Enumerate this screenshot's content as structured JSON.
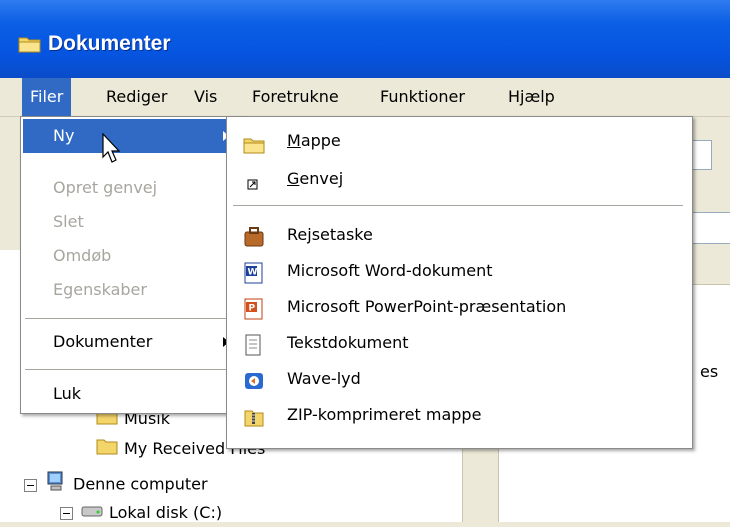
{
  "window": {
    "title": "Dokumenter"
  },
  "menubar": [
    "Filer",
    "Rediger",
    "Vis",
    "Foretrukne",
    "Funktioner",
    "Hjælp"
  ],
  "file_menu": {
    "new": "Ny",
    "create_shortcut": "Opret genvej",
    "delete": "Slet",
    "rename": "Omdøb",
    "properties": "Egenskaber",
    "documents": "Dokumenter",
    "close": "Luk"
  },
  "new_submenu": {
    "folder_first": "M",
    "folder_rest": "appe",
    "shortcut_first": "G",
    "shortcut_rest": "envej",
    "briefcase": "Rejsetaske",
    "word": "Microsoft Word-dokument",
    "powerpoint": "Microsoft PowerPoint-præsentation",
    "text": "Tekstdokument",
    "wave": "Wave-lyd",
    "zip": "ZIP-komprimeret mappe"
  },
  "tree": {
    "music": "Musik",
    "received": "My Received Files",
    "computer": "Denne computer",
    "local_disk": "Lokal disk (C:)"
  },
  "right_pane_partial": "es",
  "colors": {
    "titlebar": "#0654e0",
    "highlight": "#316ac5",
    "menu_bg": "#ece9d8"
  }
}
